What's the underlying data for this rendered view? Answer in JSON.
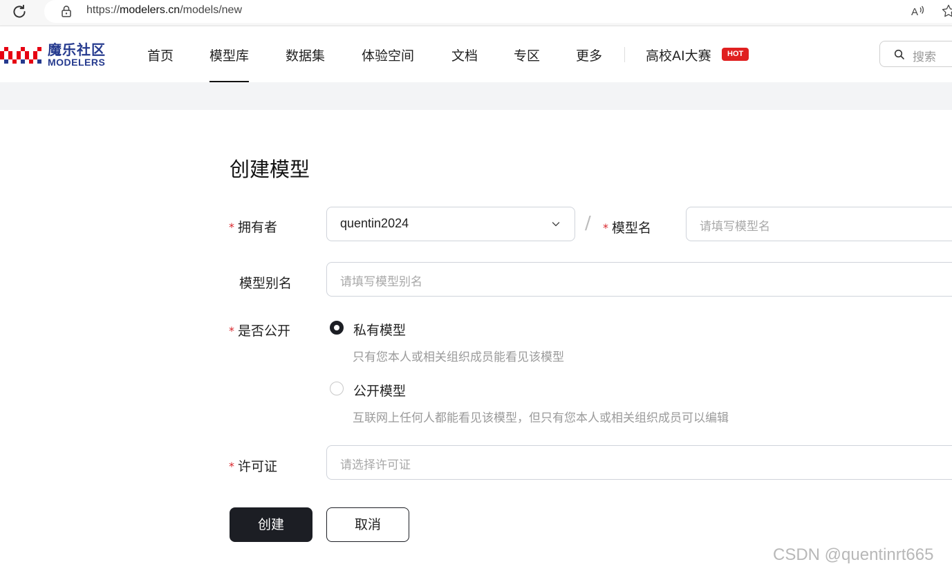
{
  "browser": {
    "url_prefix": "https://",
    "url_host": "modelers.cn",
    "url_path": "/models/new"
  },
  "header": {
    "logo_cn": "魔乐社区",
    "logo_en": "MODELERS",
    "nav": [
      {
        "label": "首页"
      },
      {
        "label": "模型库"
      },
      {
        "label": "数据集"
      },
      {
        "label": "体验空间"
      },
      {
        "label": "文档"
      },
      {
        "label": "专区"
      },
      {
        "label": "更多"
      },
      {
        "label": "高校AI大赛"
      }
    ],
    "hot_badge": "HOT",
    "search_placeholder": "搜索"
  },
  "form": {
    "title": "创建模型",
    "required_mark": "*",
    "owner_label": "拥有者",
    "owner_value": "quentin2024",
    "separator": "/",
    "model_name_label": "模型名",
    "model_name_placeholder": "请填写模型名",
    "alias_label": "模型别名",
    "alias_placeholder": "请填写模型别名",
    "visibility_label": "是否公开",
    "private_label": "私有模型",
    "private_desc": "只有您本人或相关组织成员能看见该模型",
    "public_label": "公开模型",
    "public_desc": "互联网上任何人都能看见该模型，但只有您本人或相关组织成员可以编辑",
    "license_label": "许可证",
    "license_placeholder": "请选择许可证",
    "create_button": "创建",
    "cancel_button": "取消"
  },
  "watermark": "CSDN @quentinrt665",
  "colors": {
    "brand_red": "#e60012",
    "brand_blue": "#253a8e",
    "primary_dark": "#1c1e24",
    "required_red": "#d9262c"
  }
}
